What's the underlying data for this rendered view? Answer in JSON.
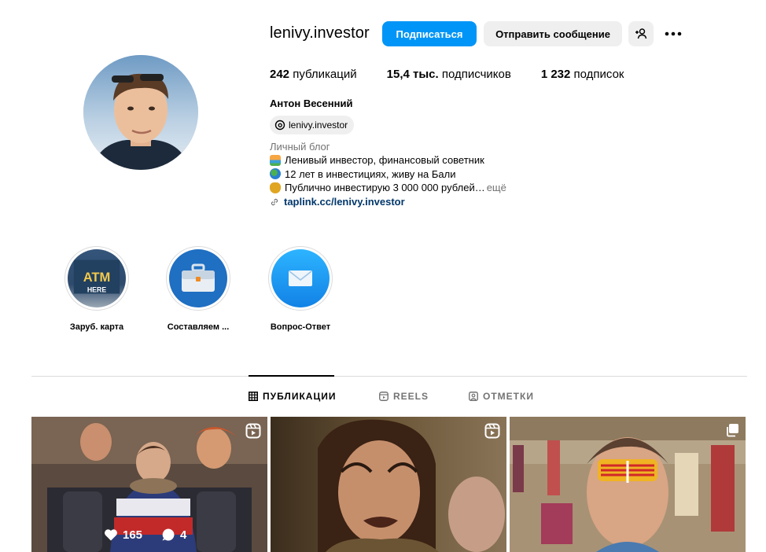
{
  "profile": {
    "username": "lenivy.investor",
    "follow_label": "Подписаться",
    "message_label": "Отправить сообщение",
    "stats": {
      "posts_value": "242",
      "posts_label": "публикаций",
      "followers_value": "15,4 тыс.",
      "followers_label": "подписчиков",
      "following_value": "1 232",
      "following_label": "подписок"
    },
    "full_name": "Антон Весенний",
    "threads_handle": "lenivy.investor",
    "category": "Личный блог",
    "bio_lines": [
      "Ленивый инвестор, финансовый советник",
      "12 лет в инвестициях, живу на Бали",
      "Публично инвестирую 3 000 000 рублей…"
    ],
    "more_label": "ещё",
    "link": "taplink.cc/lenivy.investor"
  },
  "highlights": [
    {
      "label": "Заруб. карта",
      "icon": "atm-image"
    },
    {
      "label": "Составляем ...",
      "icon": "briefcase-icon"
    },
    {
      "label": "Вопрос-Ответ",
      "icon": "envelope-icon"
    }
  ],
  "tabs": [
    {
      "label": "ПУБЛИКАЦИИ",
      "icon": "grid-icon",
      "active": true
    },
    {
      "label": "REELS",
      "icon": "reels-icon",
      "active": false
    },
    {
      "label": "ОТМЕТКИ",
      "icon": "tagged-icon",
      "active": false
    }
  ],
  "posts": [
    {
      "likes": "165",
      "comments": "4",
      "type": "reel"
    },
    {
      "type": "reel"
    },
    {
      "type": "carousel"
    }
  ],
  "colors": {
    "accent": "#0095f6",
    "link": "#00376b",
    "secondary_text": "#737373",
    "button_bg": "#efefef"
  }
}
